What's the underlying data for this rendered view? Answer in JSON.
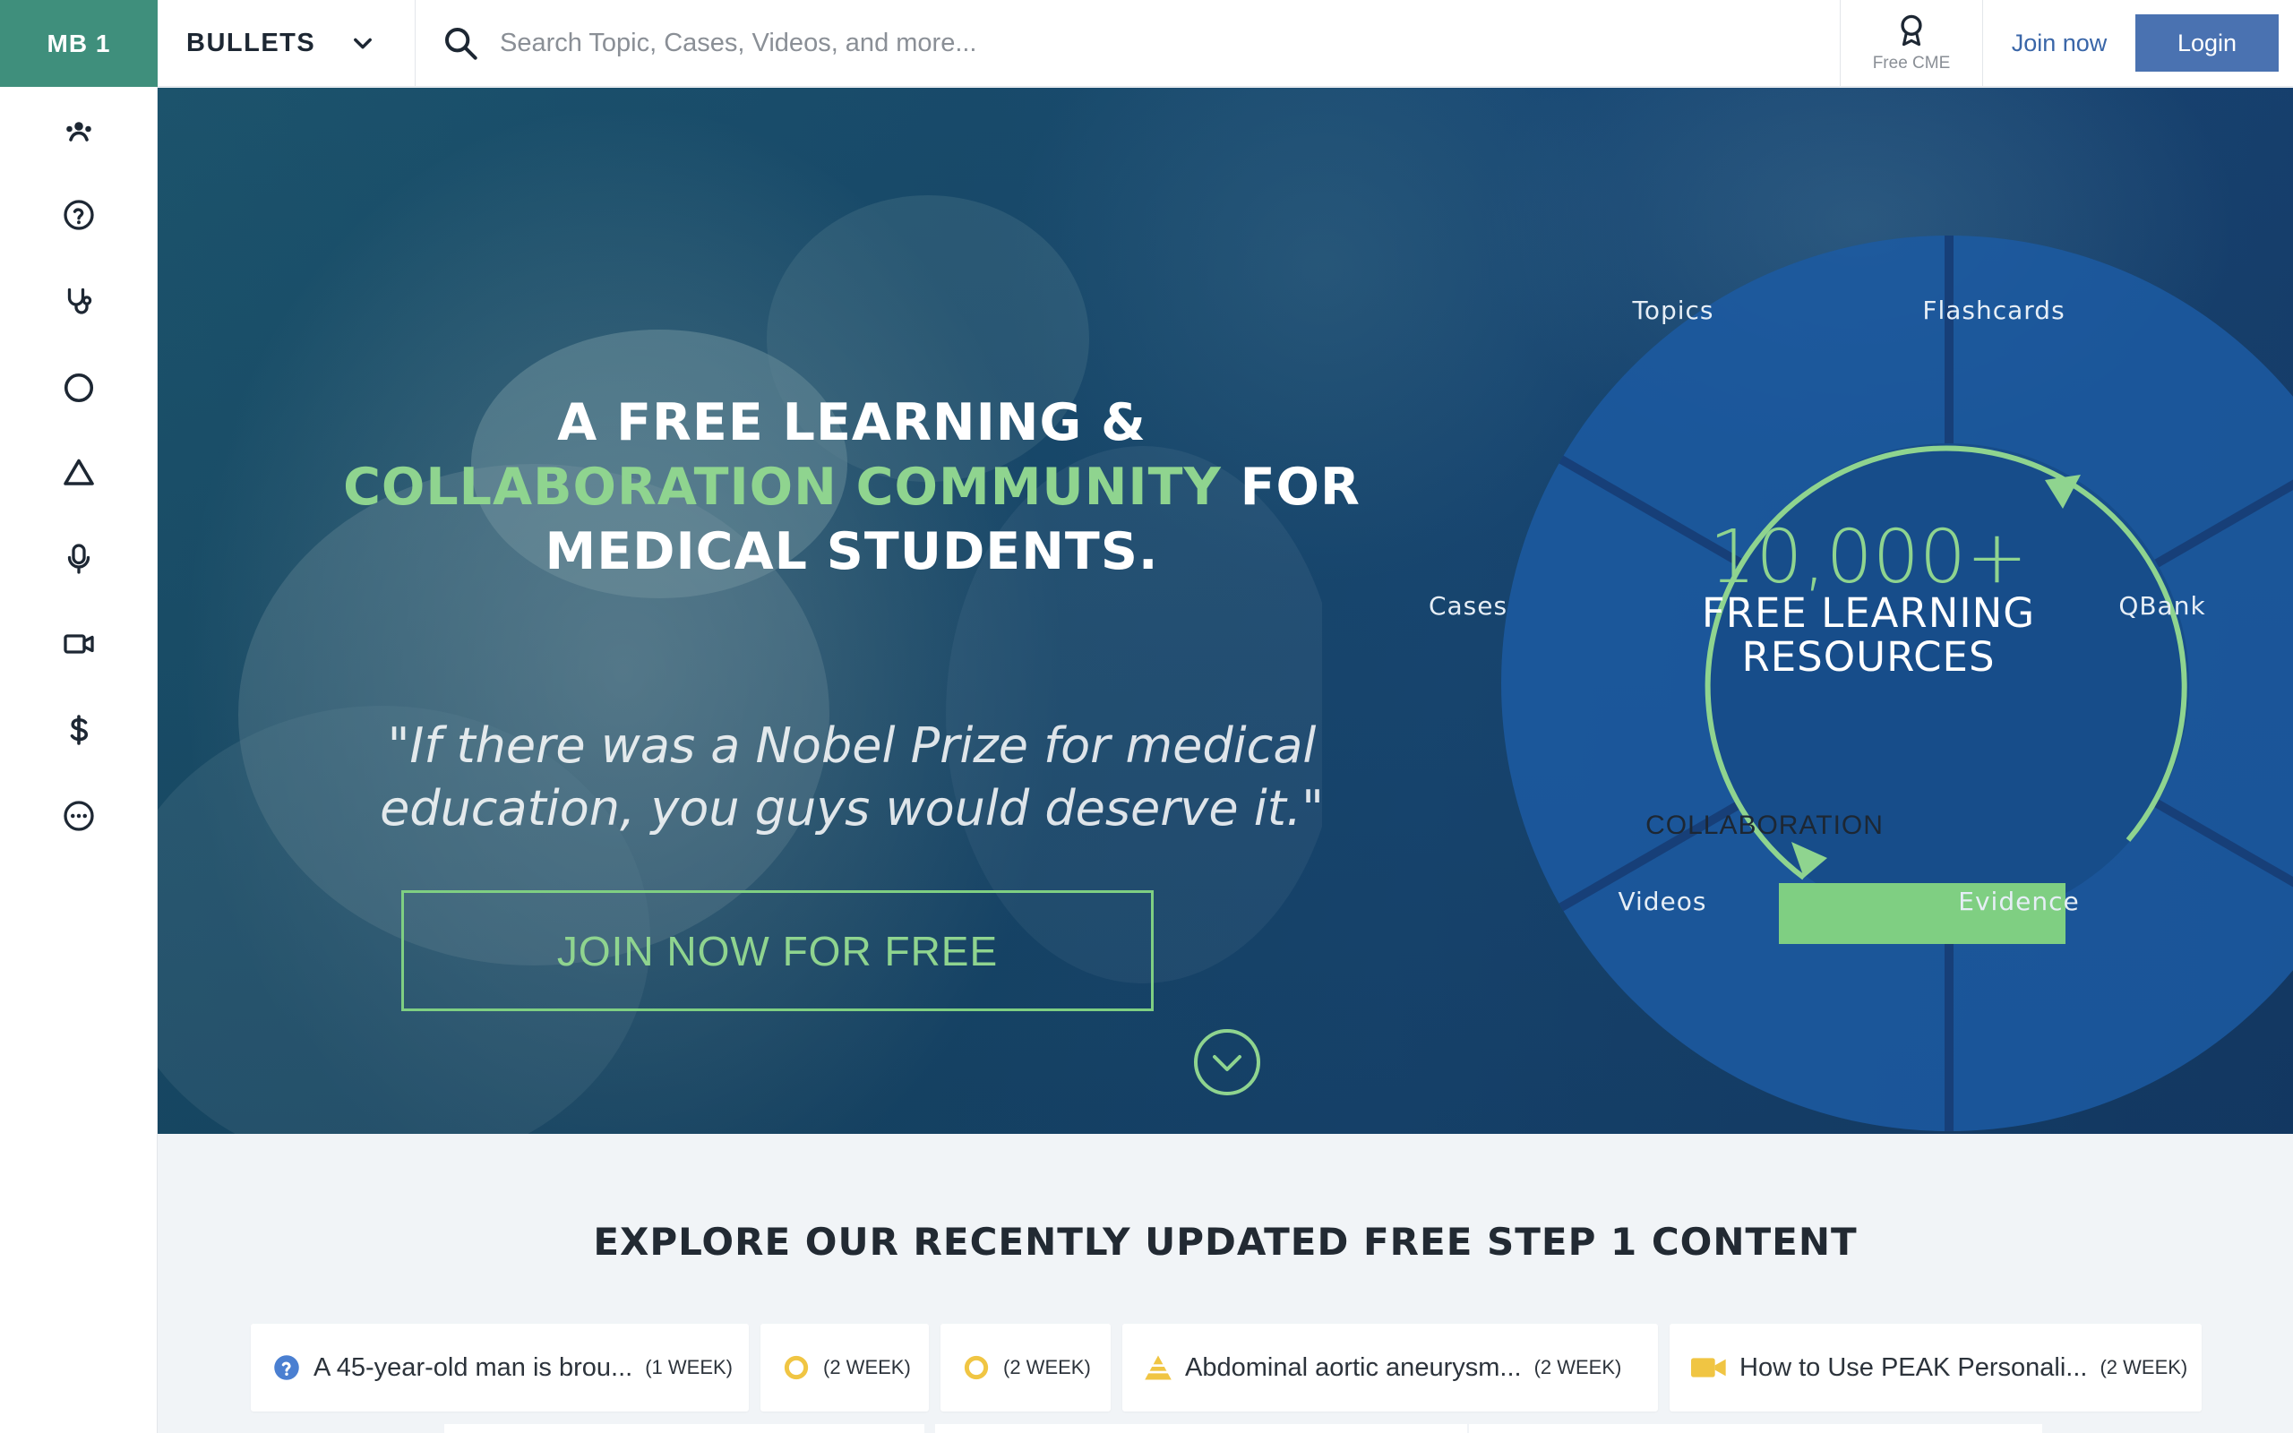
{
  "header": {
    "brand": "MB 1",
    "section": "BULLETS",
    "search_placeholder": "Search Topic, Cases, Videos, and more...",
    "cme_label": "Free CME",
    "join_label": "Join now",
    "login_label": "Login"
  },
  "sidebar": {
    "icons": [
      "community-icon",
      "question-icon",
      "stethoscope-icon",
      "circle-icon",
      "triangle-icon",
      "microphone-icon",
      "video-icon",
      "dollar-icon",
      "chat-icon"
    ]
  },
  "hero": {
    "title_line1": "A FREE LEARNING &",
    "title_accent": "COLLABORATION COMMUNITY",
    "title_for": "FOR",
    "title_line3": "MEDICAL STUDENTS.",
    "quote_line1": "\"If there was a Nobel Prize for medical",
    "quote_line2": "education, you guys would deserve it.\"",
    "cta_label": "JOIN NOW FOR FREE",
    "wheel": {
      "segments": [
        "Topics",
        "Flashcards",
        "QBank",
        "Evidence",
        "Videos",
        "Cases"
      ],
      "big_number": "10,000+",
      "center_line1": "FREE LEARNING",
      "center_line2": "RESOURCES",
      "badge": "COLLABORATION"
    },
    "accent_color": "#8fd48f"
  },
  "explore": {
    "title": "EXPLORE OUR RECENTLY UPDATED FREE STEP 1 CONTENT",
    "cards": [
      {
        "icon": "question-icon",
        "title": "A 45-year-old man is brou...",
        "age": "(1 WEEK)"
      },
      {
        "icon": "circle-icon",
        "title": "",
        "age": "(2 WEEK)"
      },
      {
        "icon": "circle-icon",
        "title": "",
        "age": "(2 WEEK)"
      },
      {
        "icon": "pyramid-icon",
        "title": "Abdominal aortic aneurysm...",
        "age": "(2 WEEK)"
      },
      {
        "icon": "video-icon",
        "title": "How to Use PEAK Personali...",
        "age": "(2 WEEK)"
      }
    ]
  }
}
